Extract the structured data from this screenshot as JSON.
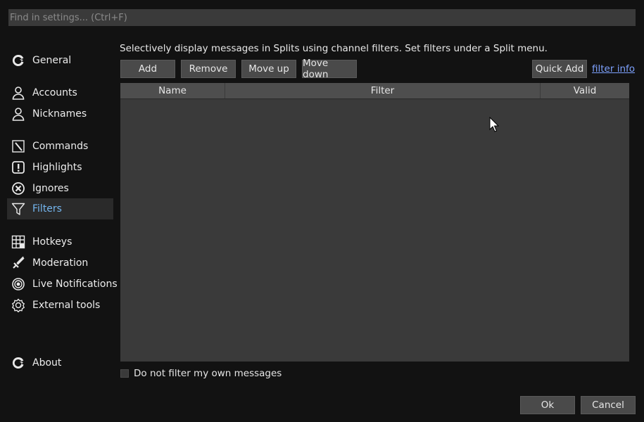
{
  "search": {
    "placeholder": "Find in settings... (Ctrl+F)"
  },
  "sidebar": {
    "items": [
      {
        "label": "General",
        "icon": "chatterino-logo-icon"
      },
      {
        "label": "Accounts",
        "icon": "person-icon"
      },
      {
        "label": "Nicknames",
        "icon": "person-icon"
      },
      {
        "label": "Commands",
        "icon": "commands-icon"
      },
      {
        "label": "Highlights",
        "icon": "exclamation-icon"
      },
      {
        "label": "Ignores",
        "icon": "x-circle-icon"
      },
      {
        "label": "Filters",
        "icon": "funnel-icon",
        "active": true
      },
      {
        "label": "Hotkeys",
        "icon": "grid-icon"
      },
      {
        "label": "Moderation",
        "icon": "sword-icon"
      },
      {
        "label": "Live Notifications",
        "icon": "target-icon"
      },
      {
        "label": "External tools",
        "icon": "gear-icon"
      },
      {
        "label": "About",
        "icon": "chatterino-logo-icon"
      }
    ]
  },
  "main": {
    "description": "Selectively display messages in Splits using channel filters. Set filters under a Split menu.",
    "toolbar": {
      "add": "Add",
      "remove": "Remove",
      "move_up": "Move up",
      "move_down": "Move down",
      "quick_add": "Quick Add",
      "filter_info": "filter info"
    },
    "table": {
      "columns": [
        "Name",
        "Filter",
        "Valid"
      ],
      "rows": []
    },
    "checkbox": {
      "label": "Do not filter my own messages",
      "checked": false
    }
  },
  "footer": {
    "ok": "Ok",
    "cancel": "Cancel"
  },
  "colors": {
    "accent": "#74b6ef",
    "link": "#7ea2ff",
    "background": "#121212"
  }
}
